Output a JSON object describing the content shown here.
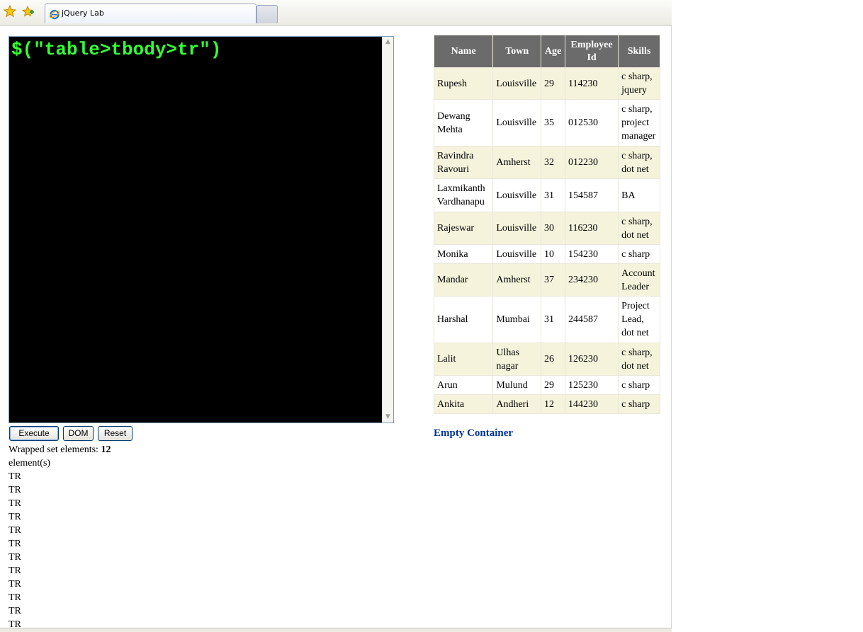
{
  "browser": {
    "tab_title": "jQuery Lab"
  },
  "console": {
    "code": "$(\"table>tbody>tr\")"
  },
  "buttons": {
    "execute": "Execute",
    "dom": "DOM",
    "reset": "Reset"
  },
  "results": {
    "prefix": "Wrapped set elements: ",
    "count": "12",
    "suffix": "element(s)",
    "elements": [
      "TR",
      "TR",
      "TR",
      "TR",
      "TR",
      "TR",
      "TR",
      "TR",
      "TR",
      "TR",
      "TR",
      "TR"
    ]
  },
  "table": {
    "headers": [
      "Name",
      "Town",
      "Age",
      "Employee Id",
      "Skills"
    ],
    "rows": [
      [
        "Rupesh",
        "Louisville",
        "29",
        "114230",
        "c sharp, jquery"
      ],
      [
        "Dewang Mehta",
        "Louisville",
        "35",
        "012530",
        "c sharp, project manager"
      ],
      [
        "Ravindra Ravouri",
        "Amherst",
        "32",
        "012230",
        "c sharp, dot net"
      ],
      [
        "Laxmikanth Vardhanapu",
        "Louisville",
        "31",
        "154587",
        "BA"
      ],
      [
        "Rajeswar",
        "Louisville",
        "30",
        "116230",
        "c sharp, dot net"
      ],
      [
        "Monika",
        "Louisville",
        "10",
        "154230",
        "c sharp"
      ],
      [
        "Mandar",
        "Amherst",
        "37",
        "234230",
        "Account Leader"
      ],
      [
        "Harshal",
        "Mumbai",
        "31",
        "244587",
        "Project Lead, dot net"
      ],
      [
        "Lalit",
        "Ulhas nagar",
        "26",
        "126230",
        "c sharp, dot net"
      ],
      [
        "Arun",
        "Mulund",
        "29",
        "125230",
        "c sharp"
      ],
      [
        "Ankita",
        "Andheri",
        "12",
        "144230",
        "c sharp"
      ]
    ]
  },
  "empty_container": {
    "label": "Empty Container",
    "color": "#003399"
  },
  "colors": {
    "console_bg": "#000000",
    "console_text": "#33ff33",
    "header_bg": "#6b6b6b",
    "odd_row_bg": "#f5f3dc"
  }
}
